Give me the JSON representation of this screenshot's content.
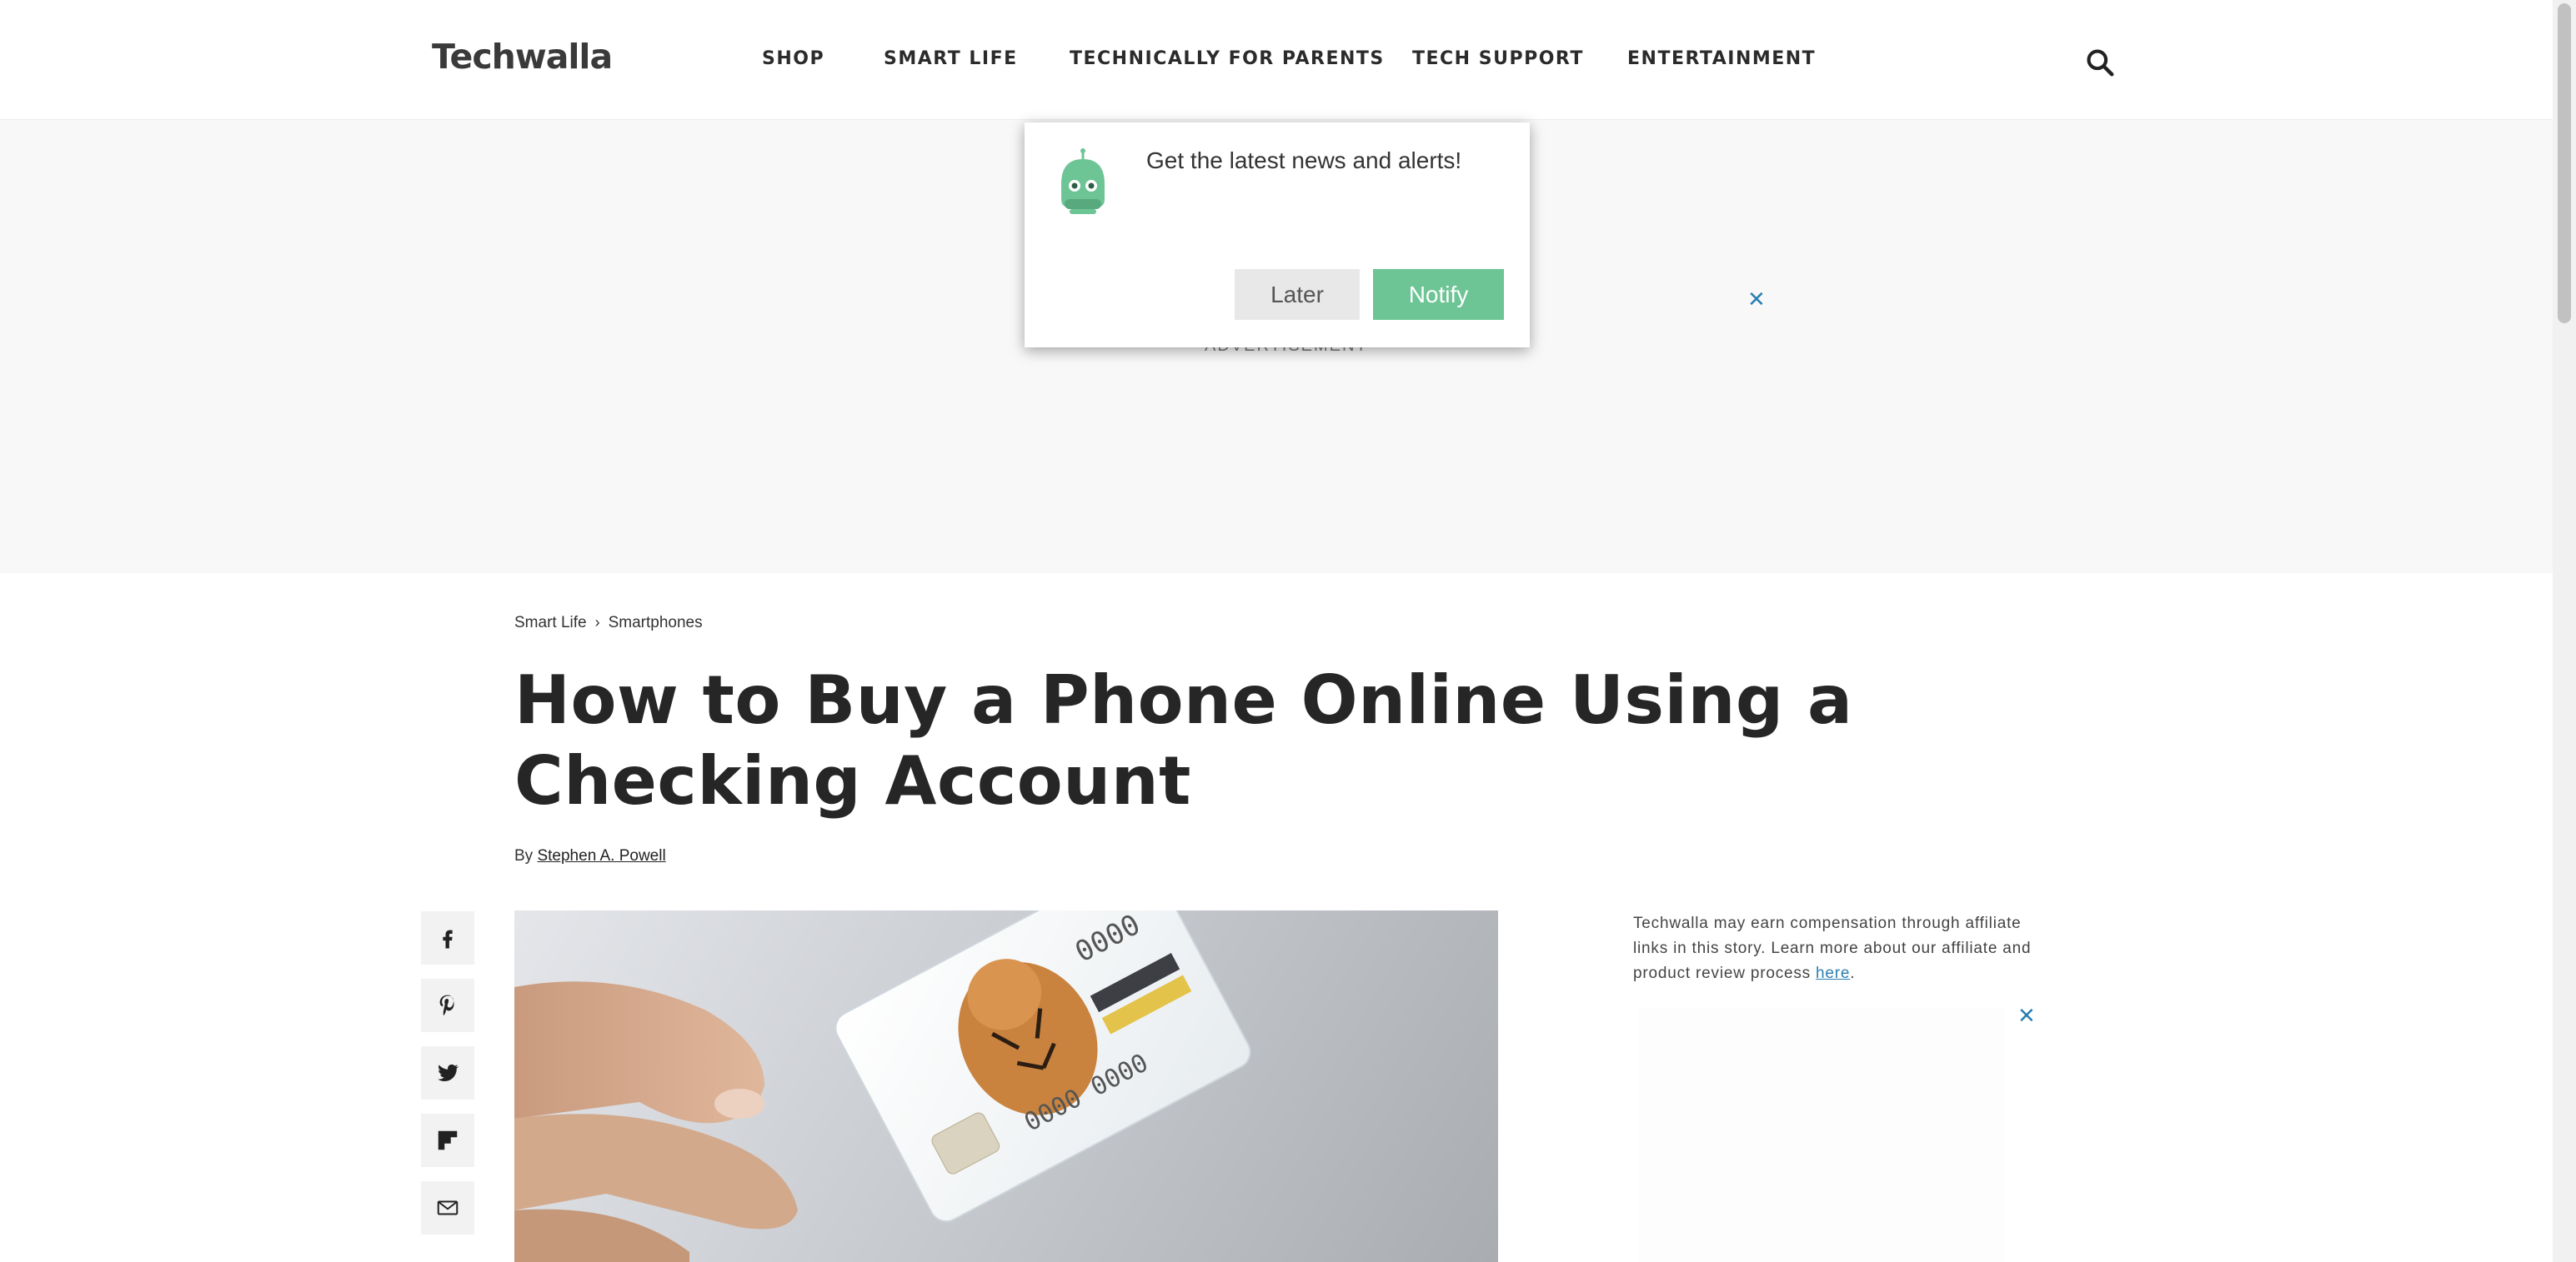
{
  "header": {
    "logo": "Techwalla",
    "nav": [
      "SHOP",
      "SMART LIFE",
      "TECHNICALLY FOR PARENTS",
      "TECH SUPPORT",
      "ENTERTAINMENT"
    ],
    "search_icon": "search-icon"
  },
  "ad_banner": {
    "label": "ADVERTISEMENT",
    "close": "✕"
  },
  "popup": {
    "message": "Get the latest news and alerts!",
    "later": "Later",
    "notify": "Notify",
    "icon": "robot-icon",
    "accent": "#6dc495"
  },
  "article": {
    "breadcrumb": [
      "Smart Life",
      "Smartphones"
    ],
    "breadcrumb_sep": "›",
    "title": "How to Buy a Phone Online Using a Checking Account",
    "byline_prefix": "By",
    "author": "Stephen A. Powell"
  },
  "share": [
    "facebook-icon",
    "pinterest-icon",
    "twitter-icon",
    "flipboard-icon",
    "email-icon"
  ],
  "sidebar": {
    "disclosure_text": "Techwalla may earn compensation through affiliate links in this story. Learn more about our affiliate and product review process ",
    "disclosure_link": "here",
    "disclosure_end": ".",
    "ad_close": "✕"
  },
  "colors": {
    "link": "#2a7fb2",
    "ad_background": "#f8f8f8"
  }
}
